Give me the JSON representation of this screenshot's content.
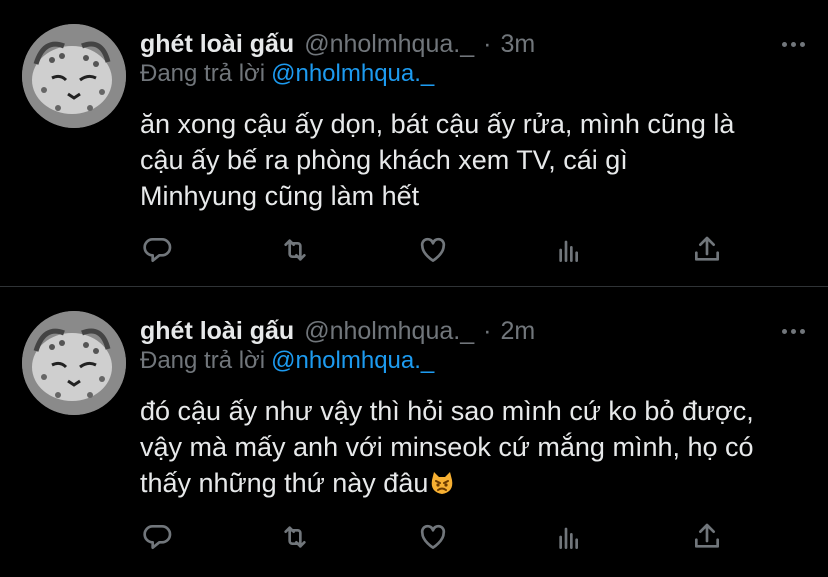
{
  "tweets": [
    {
      "author_name": "ghét loài gấu",
      "handle": "@nholmhqua._",
      "separator": "·",
      "time": "3m",
      "reply_prefix": "Đang trả lời",
      "reply_to": "@nholmhqua._",
      "text": "ăn xong cậu ấy dọn, bát cậu ấy rửa, mình cũng là\ncậu ấy bế ra phòng khách xem TV, cái gì\nMinhyung cũng làm hết",
      "emoji": ""
    },
    {
      "author_name": "ghét loài gấu",
      "handle": "@nholmhqua._",
      "separator": "·",
      "time": "2m",
      "reply_prefix": "Đang trả lời",
      "reply_to": "@nholmhqua._",
      "text": "đó cậu ấy như vậy thì hỏi sao mình cứ ko bỏ được,\nvậy mà mấy anh với minseok cứ mắng mình, họ có\nthấy những thứ này đâu",
      "emoji": "pouting-cat-face"
    }
  ],
  "icons": {
    "reply": "reply-icon",
    "retweet": "retweet-icon",
    "like": "heart-icon",
    "analytics": "analytics-icon",
    "share": "share-icon",
    "more": "more-icon"
  },
  "colors": {
    "background": "#000000",
    "text": "#e7e9ea",
    "secondary": "#71767b",
    "accent": "#1d9bf0",
    "divider": "#2f3336"
  }
}
